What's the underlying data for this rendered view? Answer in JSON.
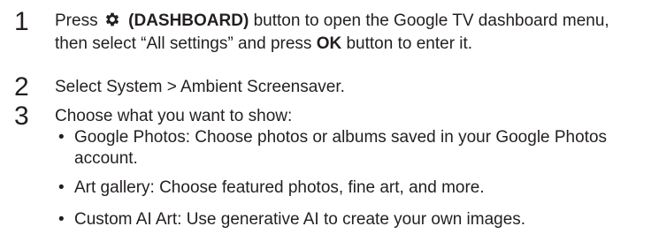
{
  "steps": [
    {
      "number": "1",
      "parts": {
        "press": "Press",
        "button_name": "(DASHBOARD)",
        "mid": "button to open the Google TV dashboard menu, then select “All settings” and press",
        "ok": "OK",
        "end": "button to enter it."
      },
      "icon": "gear-icon"
    },
    {
      "number": "2",
      "text": "Select System > Ambient Screensaver."
    },
    {
      "number": "3",
      "text": "Choose what you want to show:",
      "bullets": [
        "Google Photos: Choose photos or albums saved in your Google Photos account.",
        "Art gallery: Choose featured photos, fine art, and more.",
        "Custom AI Art: Use generative AI to create your own images."
      ]
    }
  ],
  "bullet_symbol": "•"
}
